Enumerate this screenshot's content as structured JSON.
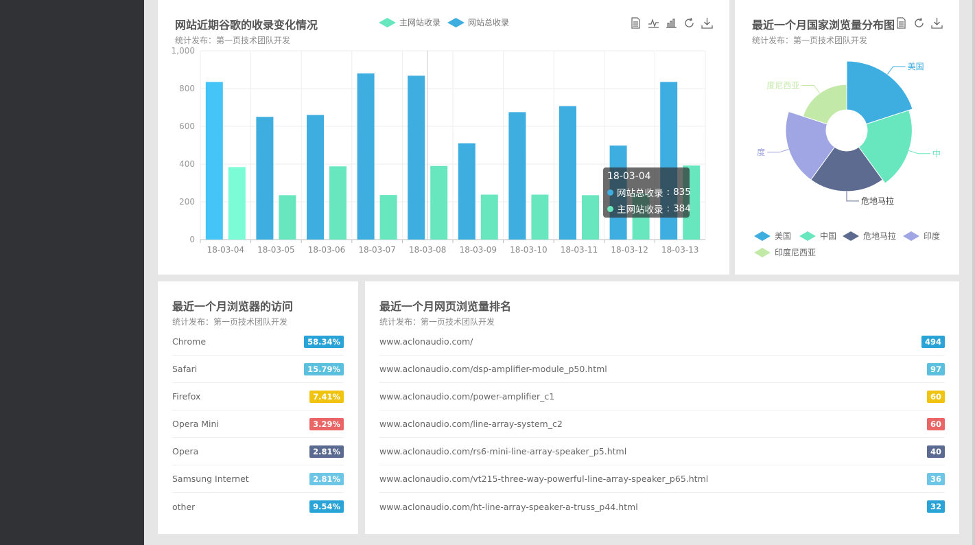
{
  "colors": {
    "sidebar": "#313235",
    "blue": "#3eaee0",
    "lightblue": "#44c4f7",
    "green": "#68e6be",
    "mint": "#7bfcd7",
    "navy": "#5d6b91",
    "lavender": "#9fa6e3",
    "lightgreen": "#c3e9a8",
    "badge_blue": "#2aa3d6",
    "badge_cyan": "#5bc0de",
    "badge_yellow": "#f0c30f",
    "badge_red": "#ea6565",
    "badge_navy": "#5b6a91",
    "badge_sky": "#6ec6e6"
  },
  "icons": [
    "data-view-icon",
    "line-chart-icon",
    "bar-chart-icon",
    "refresh-icon",
    "download-icon"
  ],
  "bar_card": {
    "title": "网站近期谷歌的收录变化情况",
    "subtitle": "统计发布：第一页技术团队开发",
    "legend": [
      "主网站收录",
      "网站总收录"
    ]
  },
  "pie_card": {
    "title": "最近一个月国家浏览量分布图",
    "subtitle": "统计发布：第一页技术团队开发",
    "legend": [
      "美国",
      "中国",
      "危地马拉",
      "印度",
      "印度尼西亚"
    ],
    "slice_labels": [
      "美国",
      "中",
      "危地马拉",
      "度",
      "度尼西亚"
    ]
  },
  "tooltip": {
    "title": "18-03-04",
    "rows": [
      {
        "name": "网站总收录",
        "value": "835"
      },
      {
        "name": "主网站收录",
        "value": "384"
      }
    ]
  },
  "browser_card": {
    "title": "最近一个月浏览器的访问",
    "subtitle": "统计发布：第一页技术团队开发",
    "rows": [
      {
        "label": "Chrome",
        "badge": "58.34%",
        "color": "#2aa3d6"
      },
      {
        "label": "Safari",
        "badge": "15.79%",
        "color": "#5bc0de"
      },
      {
        "label": "Firefox",
        "badge": "7.41%",
        "color": "#f0c30f"
      },
      {
        "label": "Opera Mini",
        "badge": "3.29%",
        "color": "#ea6565"
      },
      {
        "label": "Opera",
        "badge": "2.81%",
        "color": "#5b6a91"
      },
      {
        "label": "Samsung Internet",
        "badge": "2.81%",
        "color": "#6ec6e6"
      },
      {
        "label": "other",
        "badge": "9.54%",
        "color": "#2aa3d6"
      }
    ]
  },
  "page_card": {
    "title": "最近一个月网页浏览量排名",
    "subtitle": "统计发布：第一页技术团队开发",
    "rows": [
      {
        "label": "www.aclonaudio.com/",
        "badge": "494",
        "color": "#2aa3d6"
      },
      {
        "label": "www.aclonaudio.com/dsp-amplifier-module_p50.html",
        "badge": "97",
        "color": "#5bc0de"
      },
      {
        "label": "www.aclonaudio.com/power-amplifier_c1",
        "badge": "60",
        "color": "#f0c30f"
      },
      {
        "label": "www.aclonaudio.com/line-array-system_c2",
        "badge": "60",
        "color": "#ea6565"
      },
      {
        "label": "www.aclonaudio.com/rs6-mini-line-array-speaker_p5.html",
        "badge": "40",
        "color": "#5b6a91"
      },
      {
        "label": "www.aclonaudio.com/vt215-three-way-powerful-line-array-speaker_p65.html",
        "badge": "36",
        "color": "#6ec6e6"
      },
      {
        "label": "www.aclonaudio.com/ht-line-array-speaker-a-truss_p44.html",
        "badge": "32",
        "color": "#2aa3d6"
      }
    ]
  },
  "chart_data": [
    {
      "type": "bar",
      "title": "网站近期谷歌的收录变化情况",
      "categories": [
        "18-03-04",
        "18-03-05",
        "18-03-06",
        "18-03-07",
        "18-03-08",
        "18-03-09",
        "18-03-10",
        "18-03-11",
        "18-03-12",
        "18-03-13"
      ],
      "series": [
        {
          "name": "网站总收录",
          "color": "#3eaee0",
          "values": [
            835,
            650,
            660,
            880,
            868,
            510,
            675,
            707,
            498,
            835
          ]
        },
        {
          "name": "主网站收录",
          "color": "#68e6be",
          "values": [
            384,
            235,
            388,
            236,
            390,
            238,
            238,
            235,
            245,
            392
          ]
        }
      ],
      "yticks": [
        "0",
        "200",
        "400",
        "600",
        "800",
        "1,000"
      ],
      "ylim": [
        0,
        1000
      ],
      "grid": true,
      "legend": "top"
    },
    {
      "type": "pie",
      "style": "rose",
      "title": "最近一个月国家浏览量分布图",
      "slices": [
        {
          "name": "美国",
          "value": 100,
          "color": "#3eaee0"
        },
        {
          "name": "中国",
          "value": 92,
          "color": "#68e6be"
        },
        {
          "name": "危地马拉",
          "value": 83,
          "color": "#5d6b91"
        },
        {
          "name": "印度",
          "value": 83,
          "color": "#9fa6e3"
        },
        {
          "name": "印度尼西亚",
          "value": 52,
          "color": "#c3e9a8"
        }
      ],
      "legend": "bottom"
    }
  ]
}
